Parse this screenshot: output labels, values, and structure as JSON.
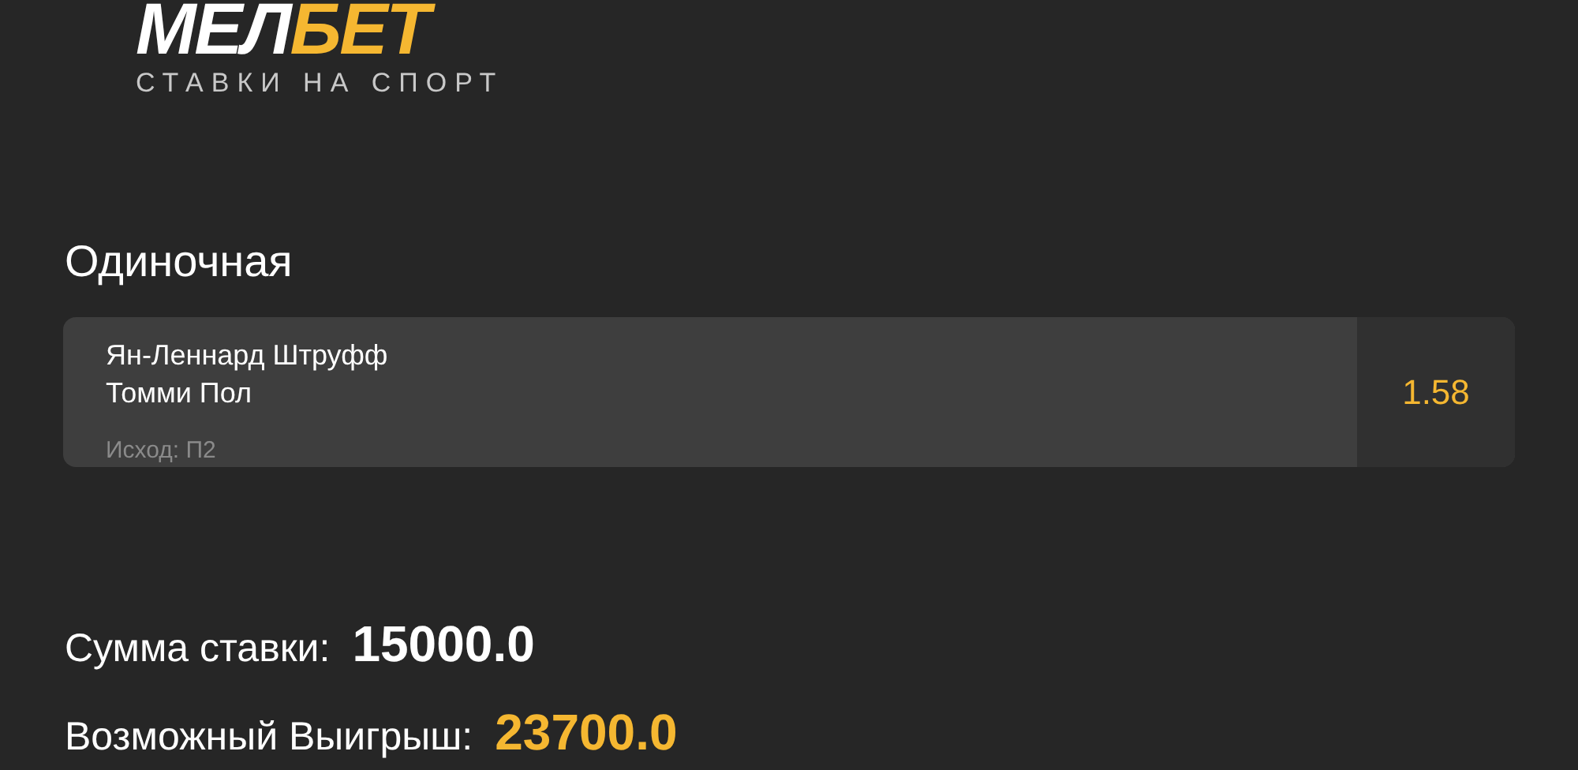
{
  "logo": {
    "parts": [
      {
        "text": "МЕЛ",
        "color": "#ffffff"
      },
      {
        "text": "БЕТ",
        "color": "#f5b731"
      }
    ],
    "tagline": "СТАВКИ НА СПОРТ"
  },
  "bet_type": "Одиночная",
  "bet": {
    "team_1": "Ян-Леннард Штруфф",
    "team_2": "Томми Пол",
    "outcome": "Исход: П2",
    "odds": "1.58"
  },
  "summary": [
    {
      "label": "Сумма ставки:",
      "value": "15000.0",
      "highlight": false
    },
    {
      "label": "Возможный Выигрыш:",
      "value": "23700.0",
      "highlight": true
    }
  ]
}
